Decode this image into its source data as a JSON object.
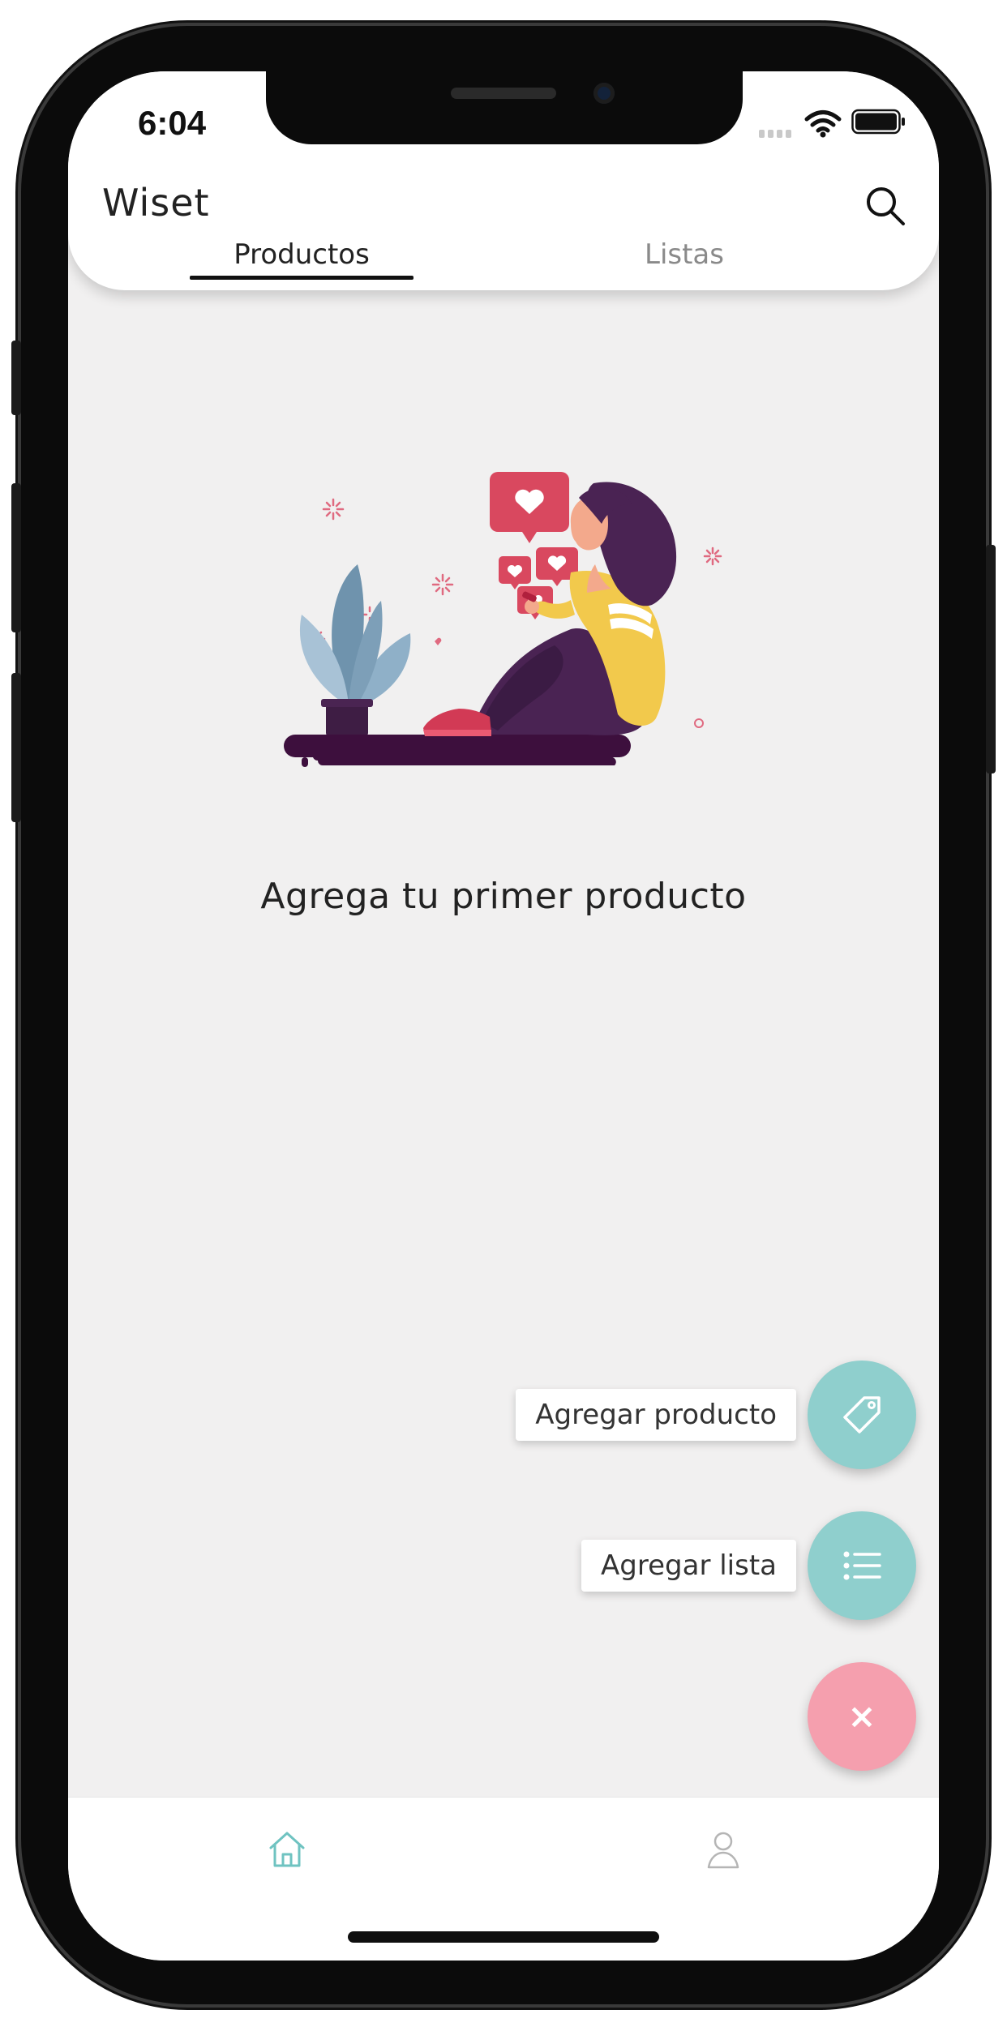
{
  "status_bar": {
    "time": "6:04"
  },
  "app": {
    "title": "Wiset"
  },
  "tabs": [
    {
      "label": "Productos",
      "active": true
    },
    {
      "label": "Listas",
      "active": false
    }
  ],
  "empty_state": {
    "message": "Agrega tu primer producto",
    "illustration": "woman-with-phone-and-plant"
  },
  "fab_menu": {
    "add_product_label": "Agregar producto",
    "add_product_icon": "tag-icon",
    "add_list_label": "Agregar lista",
    "add_list_icon": "list-icon",
    "close_icon": "close-icon",
    "close_glyph": "×"
  },
  "bottom_nav": [
    {
      "icon": "home-icon",
      "active": true
    },
    {
      "icon": "profile-icon",
      "active": false
    }
  ],
  "colors": {
    "accent_teal": "#8fcfcd",
    "accent_pink": "#f59fae",
    "background": "#f1f0f0",
    "text_dark": "#222222",
    "tab_inactive": "#8a8a8a"
  }
}
